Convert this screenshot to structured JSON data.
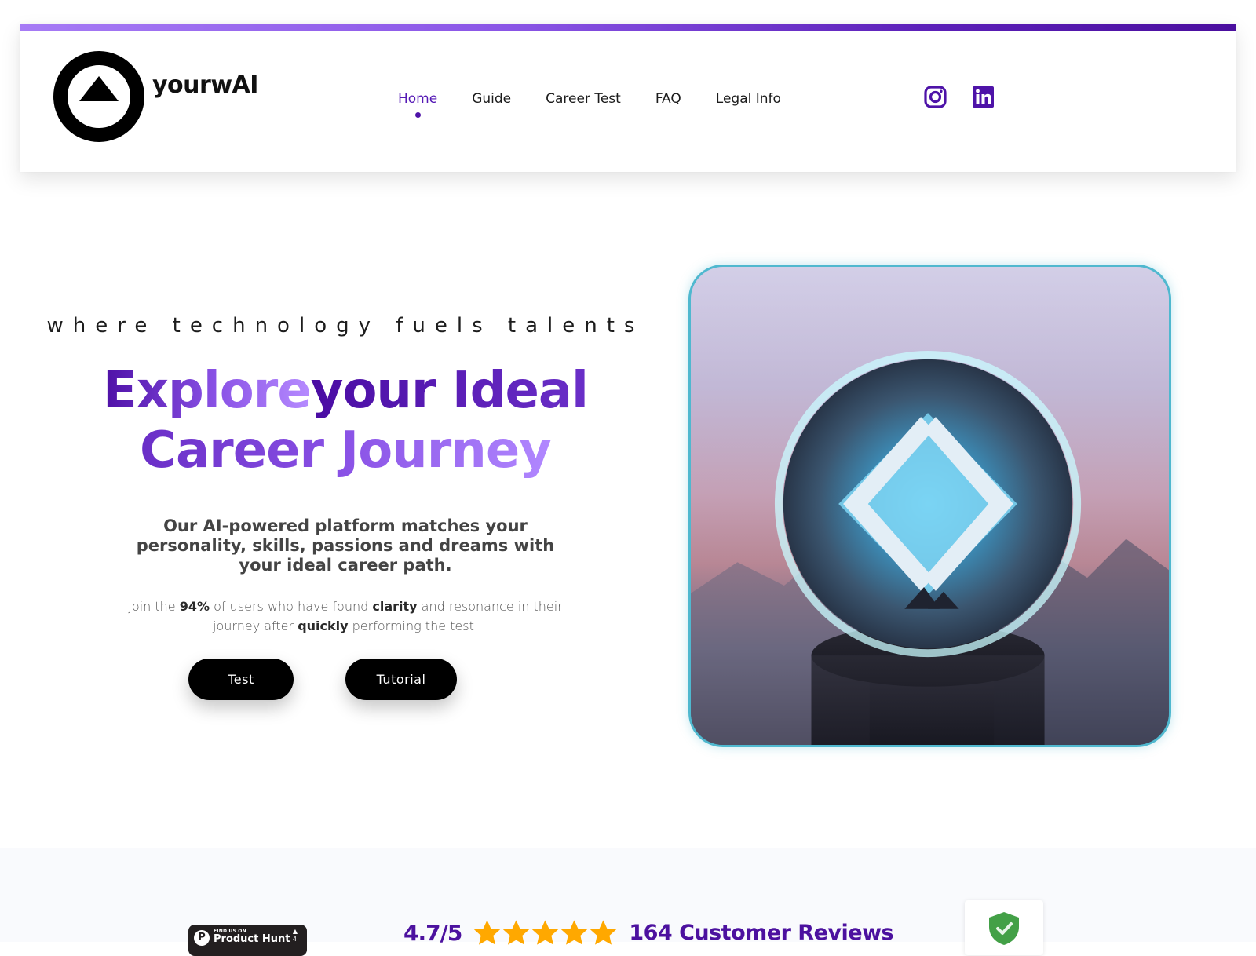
{
  "brand": {
    "name": "yourwAI",
    "accent": "#5519b5",
    "bar_gradient": [
      "#a67bf5",
      "#4a0e9e"
    ]
  },
  "nav": {
    "items": [
      {
        "label": "Home",
        "active": true
      },
      {
        "label": "Guide",
        "active": false
      },
      {
        "label": "Career Test",
        "active": false
      },
      {
        "label": "FAQ",
        "active": false
      },
      {
        "label": "Legal Info",
        "active": false
      }
    ]
  },
  "social": [
    {
      "name": "instagram-icon",
      "label": "Instagram"
    },
    {
      "name": "linkedin-icon",
      "label": "LinkedIn"
    }
  ],
  "hero": {
    "tagline": "where technology fuels talents",
    "headline": {
      "part1": "Explore",
      "part2": "your Ideal",
      "part3": "Career Journey"
    },
    "subhead": "Our AI-powered platform matches your personality, skills, passions and dreams with your ideal career path.",
    "body": {
      "t1": "Join the ",
      "b1": "94%",
      "t2": " of users who have found ",
      "b2": "clarity",
      "t3": " and resonance in their journey after ",
      "b3": "quickly",
      "t4": " performing the test."
    },
    "buttons": {
      "test": "Test",
      "tutorial": "Tutorial"
    },
    "image_alt": "Crystal ball with glowing diamond logo over misty mountains"
  },
  "reviews": {
    "product_hunt": {
      "small": "FIND US ON",
      "big": "Product Hunt",
      "upvotes": "4"
    },
    "score": "4.7/5",
    "stars": 5,
    "star_color": "#ffa800",
    "count_label": "164 Customer Reviews",
    "trust_badge": "shield-check-icon"
  }
}
